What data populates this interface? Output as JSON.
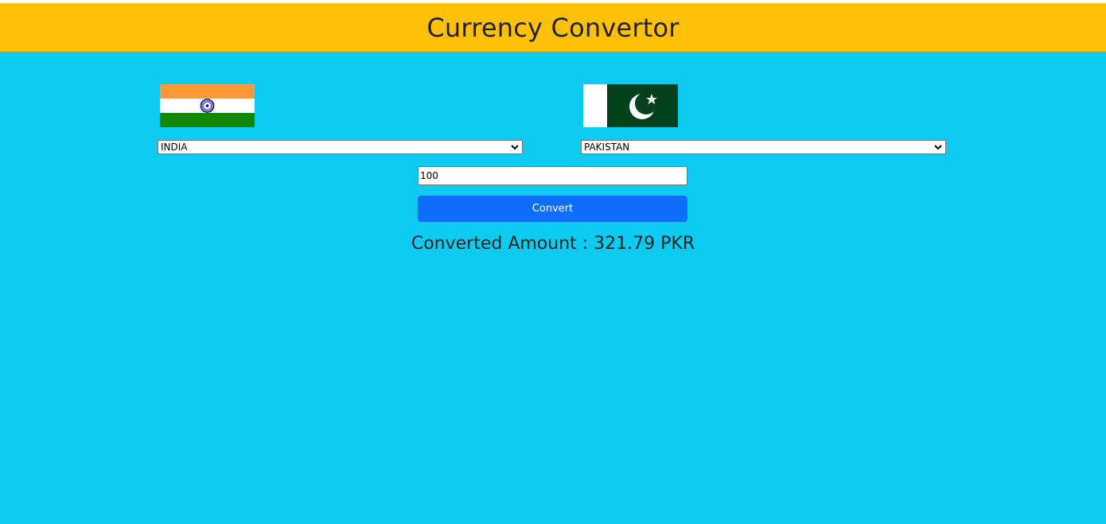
{
  "header": {
    "title": "Currency Convertor"
  },
  "converter": {
    "from": {
      "selected": "INDIA",
      "flag_icon": "india-flag-icon"
    },
    "to": {
      "selected": "PAKISTAN",
      "flag_icon": "pakistan-flag-icon"
    },
    "amount": {
      "value": "100"
    },
    "convert_label": "Convert",
    "result_text": "Converted Amount : 321.79 PKR"
  },
  "colors": {
    "header_bg": "#ffc107",
    "main_bg": "#0dcaf0",
    "button_bg": "#0d6efd",
    "text_dark": "#212529"
  }
}
